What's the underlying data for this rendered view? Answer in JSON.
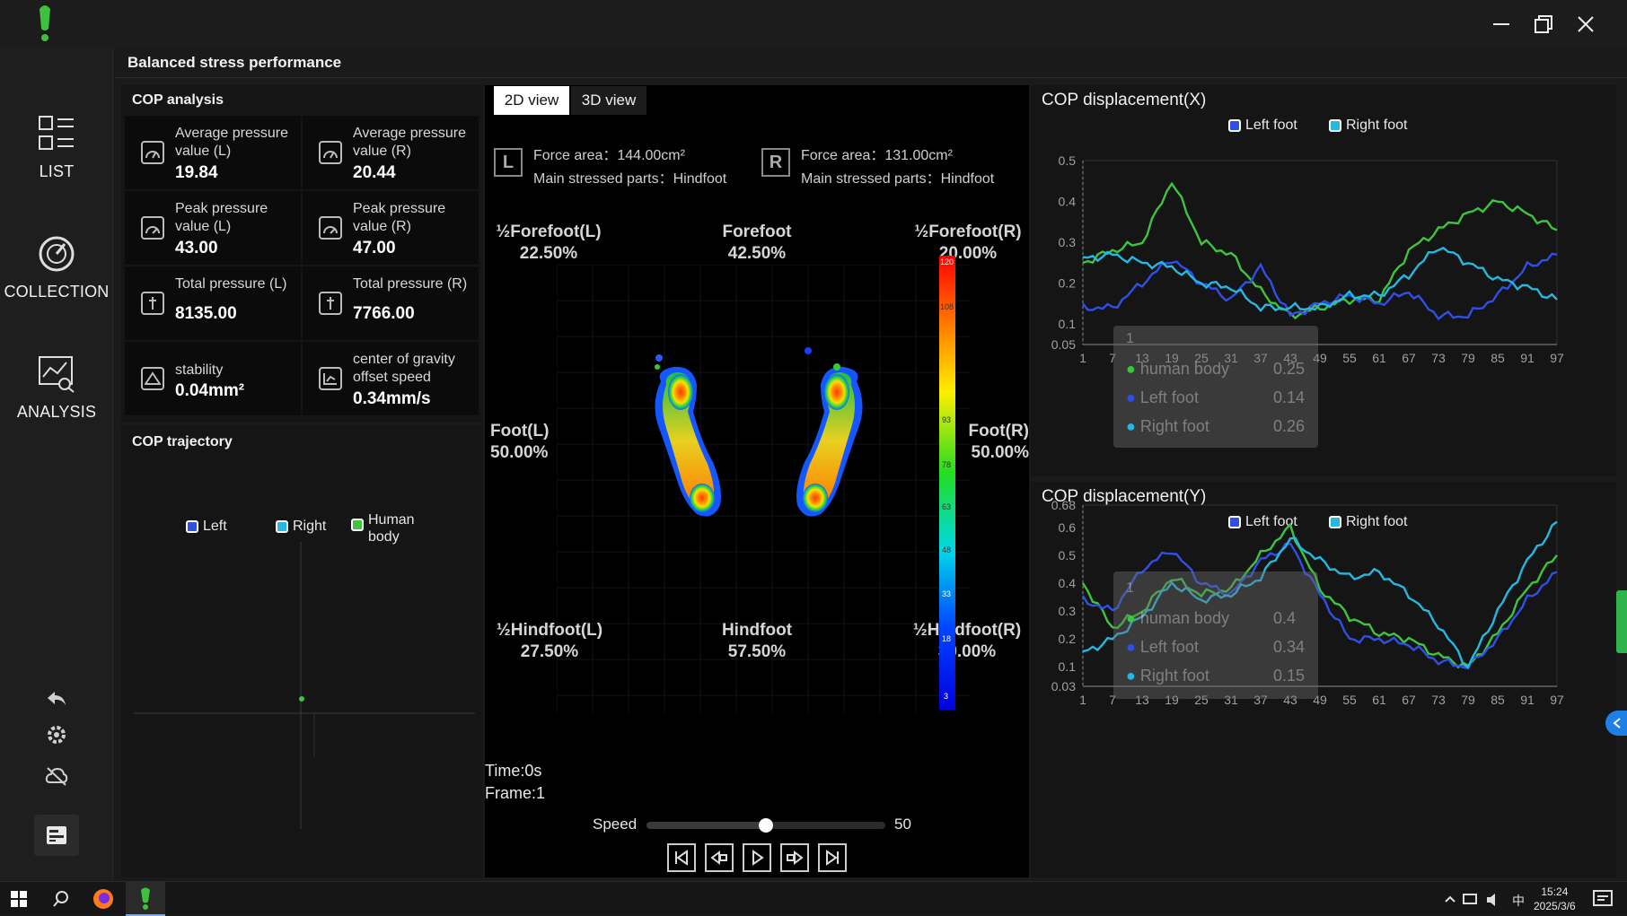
{
  "window": {
    "minimize": "minimize",
    "maximize": "restore",
    "close": "close"
  },
  "nav": {
    "list": "LIST",
    "collection": "COLLECTION",
    "analysis": "ANALYSIS"
  },
  "page_title": "Balanced stress performance",
  "cop_analysis": {
    "title": "COP analysis",
    "cells": [
      {
        "label": "Average pressure value (L)",
        "value": "19.84"
      },
      {
        "label": "Average pressure value (R)",
        "value": "20.44"
      },
      {
        "label": "Peak pressure value (L)",
        "value": "43.00"
      },
      {
        "label": "Peak pressure value (R)",
        "value": "47.00"
      },
      {
        "label": "Total pressure (L)",
        "value": "8135.00"
      },
      {
        "label": "Total pressure (R)",
        "value": "7766.00"
      },
      {
        "label": "stability",
        "value": "0.04mm²"
      },
      {
        "label": "center of gravity offset speed",
        "value": "0.34mm/s"
      }
    ]
  },
  "cop_trajectory": {
    "title": "COP trajectory",
    "legend": [
      "Left",
      "Right",
      "Human body"
    ]
  },
  "view_tabs": {
    "tab2d": "2D view",
    "tab3d": "3D view"
  },
  "foot_info": {
    "left_badge": "L",
    "left_area": "Force area：144.00cm²",
    "left_part": "Main stressed parts：Hindfoot",
    "right_badge": "R",
    "right_area": "Force area：131.00cm²",
    "right_part": "Main stressed parts：Hindfoot"
  },
  "zones": {
    "half_forefoot_l": "½Forefoot(L)",
    "half_forefoot_l_pct": "22.50%",
    "forefoot": "Forefoot",
    "forefoot_pct": "42.50%",
    "half_forefoot_r": "½Forefoot(R)",
    "half_forefoot_r_pct": "20.00%",
    "foot_l": "Foot(L)",
    "foot_l_pct": "50.00%",
    "foot_r": "Foot(R)",
    "foot_r_pct": "50.00%",
    "half_hindfoot_l": "½Hindfoot(L)",
    "half_hindfoot_l_pct": "27.50%",
    "hindfoot": "Hindfoot",
    "hindfoot_pct": "57.50%",
    "half_hindfoot_r": "½Hindfoot(R)",
    "half_hindfoot_r_pct": "30.00%"
  },
  "colorbar_ticks": [
    "120",
    "108",
    "93",
    "78",
    "63",
    "48",
    "33",
    "18",
    "3"
  ],
  "playback": {
    "time": "Time:0s",
    "frame": "Frame:1",
    "speed_label": "Speed",
    "speed_value": "50",
    "speed_fraction": 0.5
  },
  "chart_x": {
    "title": "COP displacement(X)",
    "legend": [
      "Left foot",
      "Right foot"
    ],
    "yticks": [
      "0.5",
      "0.4",
      "0.3",
      "0.2",
      "0.1",
      "0.05"
    ],
    "xticks": [
      "1",
      "7",
      "13",
      "19",
      "25",
      "31",
      "37",
      "43",
      "49",
      "55",
      "61",
      "67",
      "73",
      "79",
      "85",
      "91",
      "97"
    ],
    "tooltip": {
      "index": "1",
      "rows": [
        {
          "name": "human body",
          "value": "0.25"
        },
        {
          "name": "Left foot",
          "value": "0.14"
        },
        {
          "name": "Right foot",
          "value": "0.26"
        }
      ]
    }
  },
  "chart_y": {
    "title": "COP displacement(Y)",
    "legend": [
      "Left foot",
      "Right foot"
    ],
    "yticks": [
      "0.68",
      "0.6",
      "0.5",
      "0.4",
      "0.3",
      "0.2",
      "0.1",
      "0.03"
    ],
    "xticks": [
      "1",
      "7",
      "13",
      "19",
      "25",
      "31",
      "37",
      "43",
      "49",
      "55",
      "61",
      "67",
      "73",
      "79",
      "85",
      "91",
      "97"
    ],
    "tooltip": {
      "index": "1",
      "rows": [
        {
          "name": "human body",
          "value": "0.4"
        },
        {
          "name": "Left foot",
          "value": "0.34"
        },
        {
          "name": "Right foot",
          "value": "0.15"
        }
      ]
    }
  },
  "colors": {
    "human_body": "#3ec43e",
    "left_foot": "#2f4fe6",
    "right_foot": "#26b8e0"
  },
  "chart_data": [
    {
      "type": "line",
      "title": "COP displacement(X)",
      "ylim": [
        0.05,
        0.5
      ],
      "x": [
        1,
        7,
        13,
        19,
        25,
        31,
        37,
        43,
        49,
        55,
        61,
        67,
        73,
        79,
        85,
        91,
        97
      ],
      "series": [
        {
          "name": "human body",
          "values": [
            0.25,
            0.28,
            0.3,
            0.45,
            0.3,
            0.27,
            0.18,
            0.12,
            0.14,
            0.16,
            0.16,
            0.28,
            0.33,
            0.37,
            0.4,
            0.37,
            0.33
          ]
        },
        {
          "name": "Left foot",
          "values": [
            0.14,
            0.14,
            0.2,
            0.26,
            0.2,
            0.16,
            0.24,
            0.12,
            0.15,
            0.17,
            0.15,
            0.18,
            0.12,
            0.12,
            0.17,
            0.24,
            0.27
          ]
        },
        {
          "name": "Right foot",
          "values": [
            0.26,
            0.27,
            0.25,
            0.24,
            0.2,
            0.19,
            0.14,
            0.14,
            0.14,
            0.17,
            0.17,
            0.22,
            0.29,
            0.25,
            0.21,
            0.19,
            0.16
          ]
        }
      ]
    },
    {
      "type": "line",
      "title": "COP displacement(Y)",
      "ylim": [
        0.03,
        0.68
      ],
      "x": [
        1,
        7,
        13,
        19,
        25,
        31,
        37,
        43,
        49,
        55,
        61,
        67,
        73,
        79,
        85,
        91,
        97
      ],
      "series": [
        {
          "name": "human body",
          "values": [
            0.4,
            0.24,
            0.3,
            0.42,
            0.36,
            0.38,
            0.5,
            0.6,
            0.38,
            0.28,
            0.22,
            0.2,
            0.14,
            0.1,
            0.22,
            0.38,
            0.5
          ]
        },
        {
          "name": "Left foot",
          "values": [
            0.34,
            0.3,
            0.45,
            0.52,
            0.4,
            0.36,
            0.48,
            0.54,
            0.36,
            0.2,
            0.2,
            0.18,
            0.12,
            0.1,
            0.2,
            0.34,
            0.44
          ]
        },
        {
          "name": "Right foot",
          "values": [
            0.15,
            0.2,
            0.28,
            0.4,
            0.34,
            0.36,
            0.42,
            0.56,
            0.48,
            0.42,
            0.44,
            0.36,
            0.25,
            0.1,
            0.3,
            0.48,
            0.62
          ]
        }
      ]
    }
  ]
}
